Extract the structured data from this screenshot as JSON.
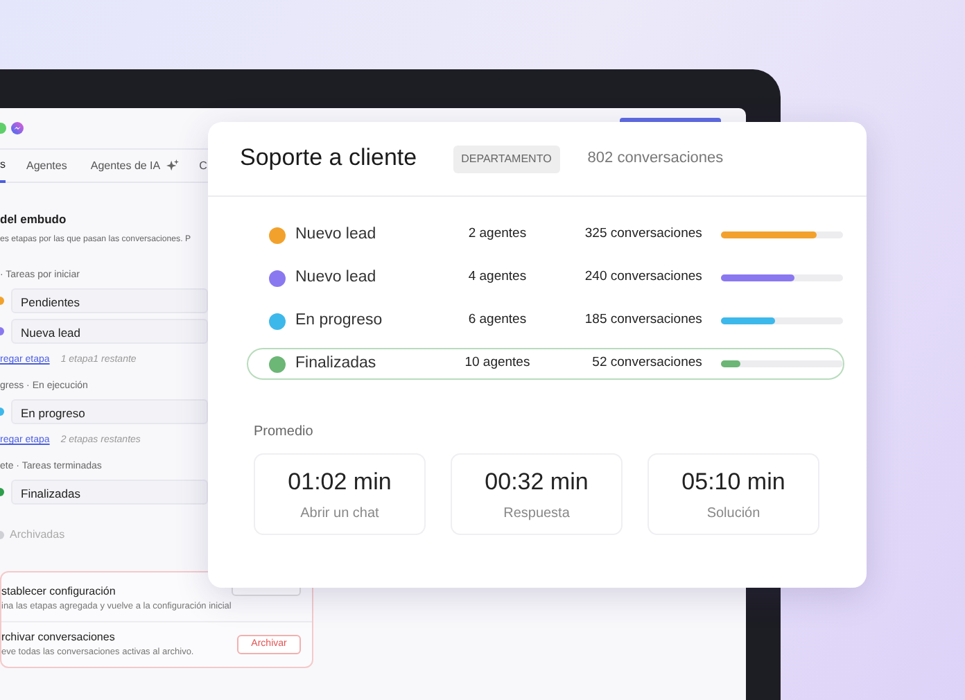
{
  "app": {
    "tabs": [
      {
        "label": "s",
        "selected": true,
        "kind": "plain"
      },
      {
        "label": "Agentes",
        "selected": false,
        "kind": "plain"
      },
      {
        "label": "Agentes de IA",
        "selected": false,
        "kind": "ai"
      },
      {
        "label": "C",
        "selected": false,
        "kind": "plain"
      }
    ],
    "section_title": "del embudo",
    "section_description": "es etapas por las que pasan las conversaciones. P",
    "groups": [
      {
        "label": "· Tareas por iniciar",
        "stages": [
          {
            "name": "Pendientes",
            "color": "#f2a22c"
          },
          {
            "name": "Nueva lead",
            "color": "#8a78f0"
          }
        ],
        "add_link": "regar etapa",
        "remaining": "1 etapa1 restante"
      },
      {
        "label": "gress · En ejecución",
        "stages": [
          {
            "name": "En progreso",
            "color": "#3db8ea"
          }
        ],
        "add_link": "regar etapa",
        "remaining": "2 etapas restantes"
      },
      {
        "label": "ete · Tareas terminadas",
        "stages": [
          {
            "name": "Finalizadas",
            "color": "#2e9e4a"
          }
        ]
      }
    ],
    "archived": "Archivadas",
    "settings": [
      {
        "kind": "reset",
        "title": "stablecer configuración",
        "description": "ina las etapas agregada y vuelve a la configuración inicial"
      },
      {
        "kind": "archive",
        "title": "rchivar conversaciones",
        "description": "eve todas las conversaciones activas al archivo.",
        "button": "Archivar"
      }
    ]
  },
  "panel": {
    "title": "Soporte a cliente",
    "badge": "DEPARTAMENTO",
    "count": "802 conversaciones",
    "stages": [
      {
        "name": "Nuevo lead",
        "color": "#f2a22c",
        "agents": "2 agentes",
        "conversations": "325 conversaciones",
        "level": 0.78,
        "selected": false
      },
      {
        "name": "Nuevo lead",
        "color": "#8a78f0",
        "agents": "4 agentes",
        "conversations": "240 conversaciones",
        "level": 0.6,
        "selected": false
      },
      {
        "name": "En progreso",
        "color": "#3db8ea",
        "agents": "6 agentes",
        "conversations": "185 conversaciones",
        "level": 0.44,
        "selected": false
      },
      {
        "name": "Finalizadas",
        "color": "#6cb676",
        "agents": "10 agentes",
        "conversations": "52 conversaciones",
        "level": 0.16,
        "selected": true
      }
    ],
    "average": {
      "label": "Promedio",
      "stats": [
        {
          "value": "01:02 min",
          "label": "Abrir un chat"
        },
        {
          "value": "00:32 min",
          "label": "Respuesta"
        },
        {
          "value": "05:10 min",
          "label": "Solución"
        }
      ]
    }
  }
}
